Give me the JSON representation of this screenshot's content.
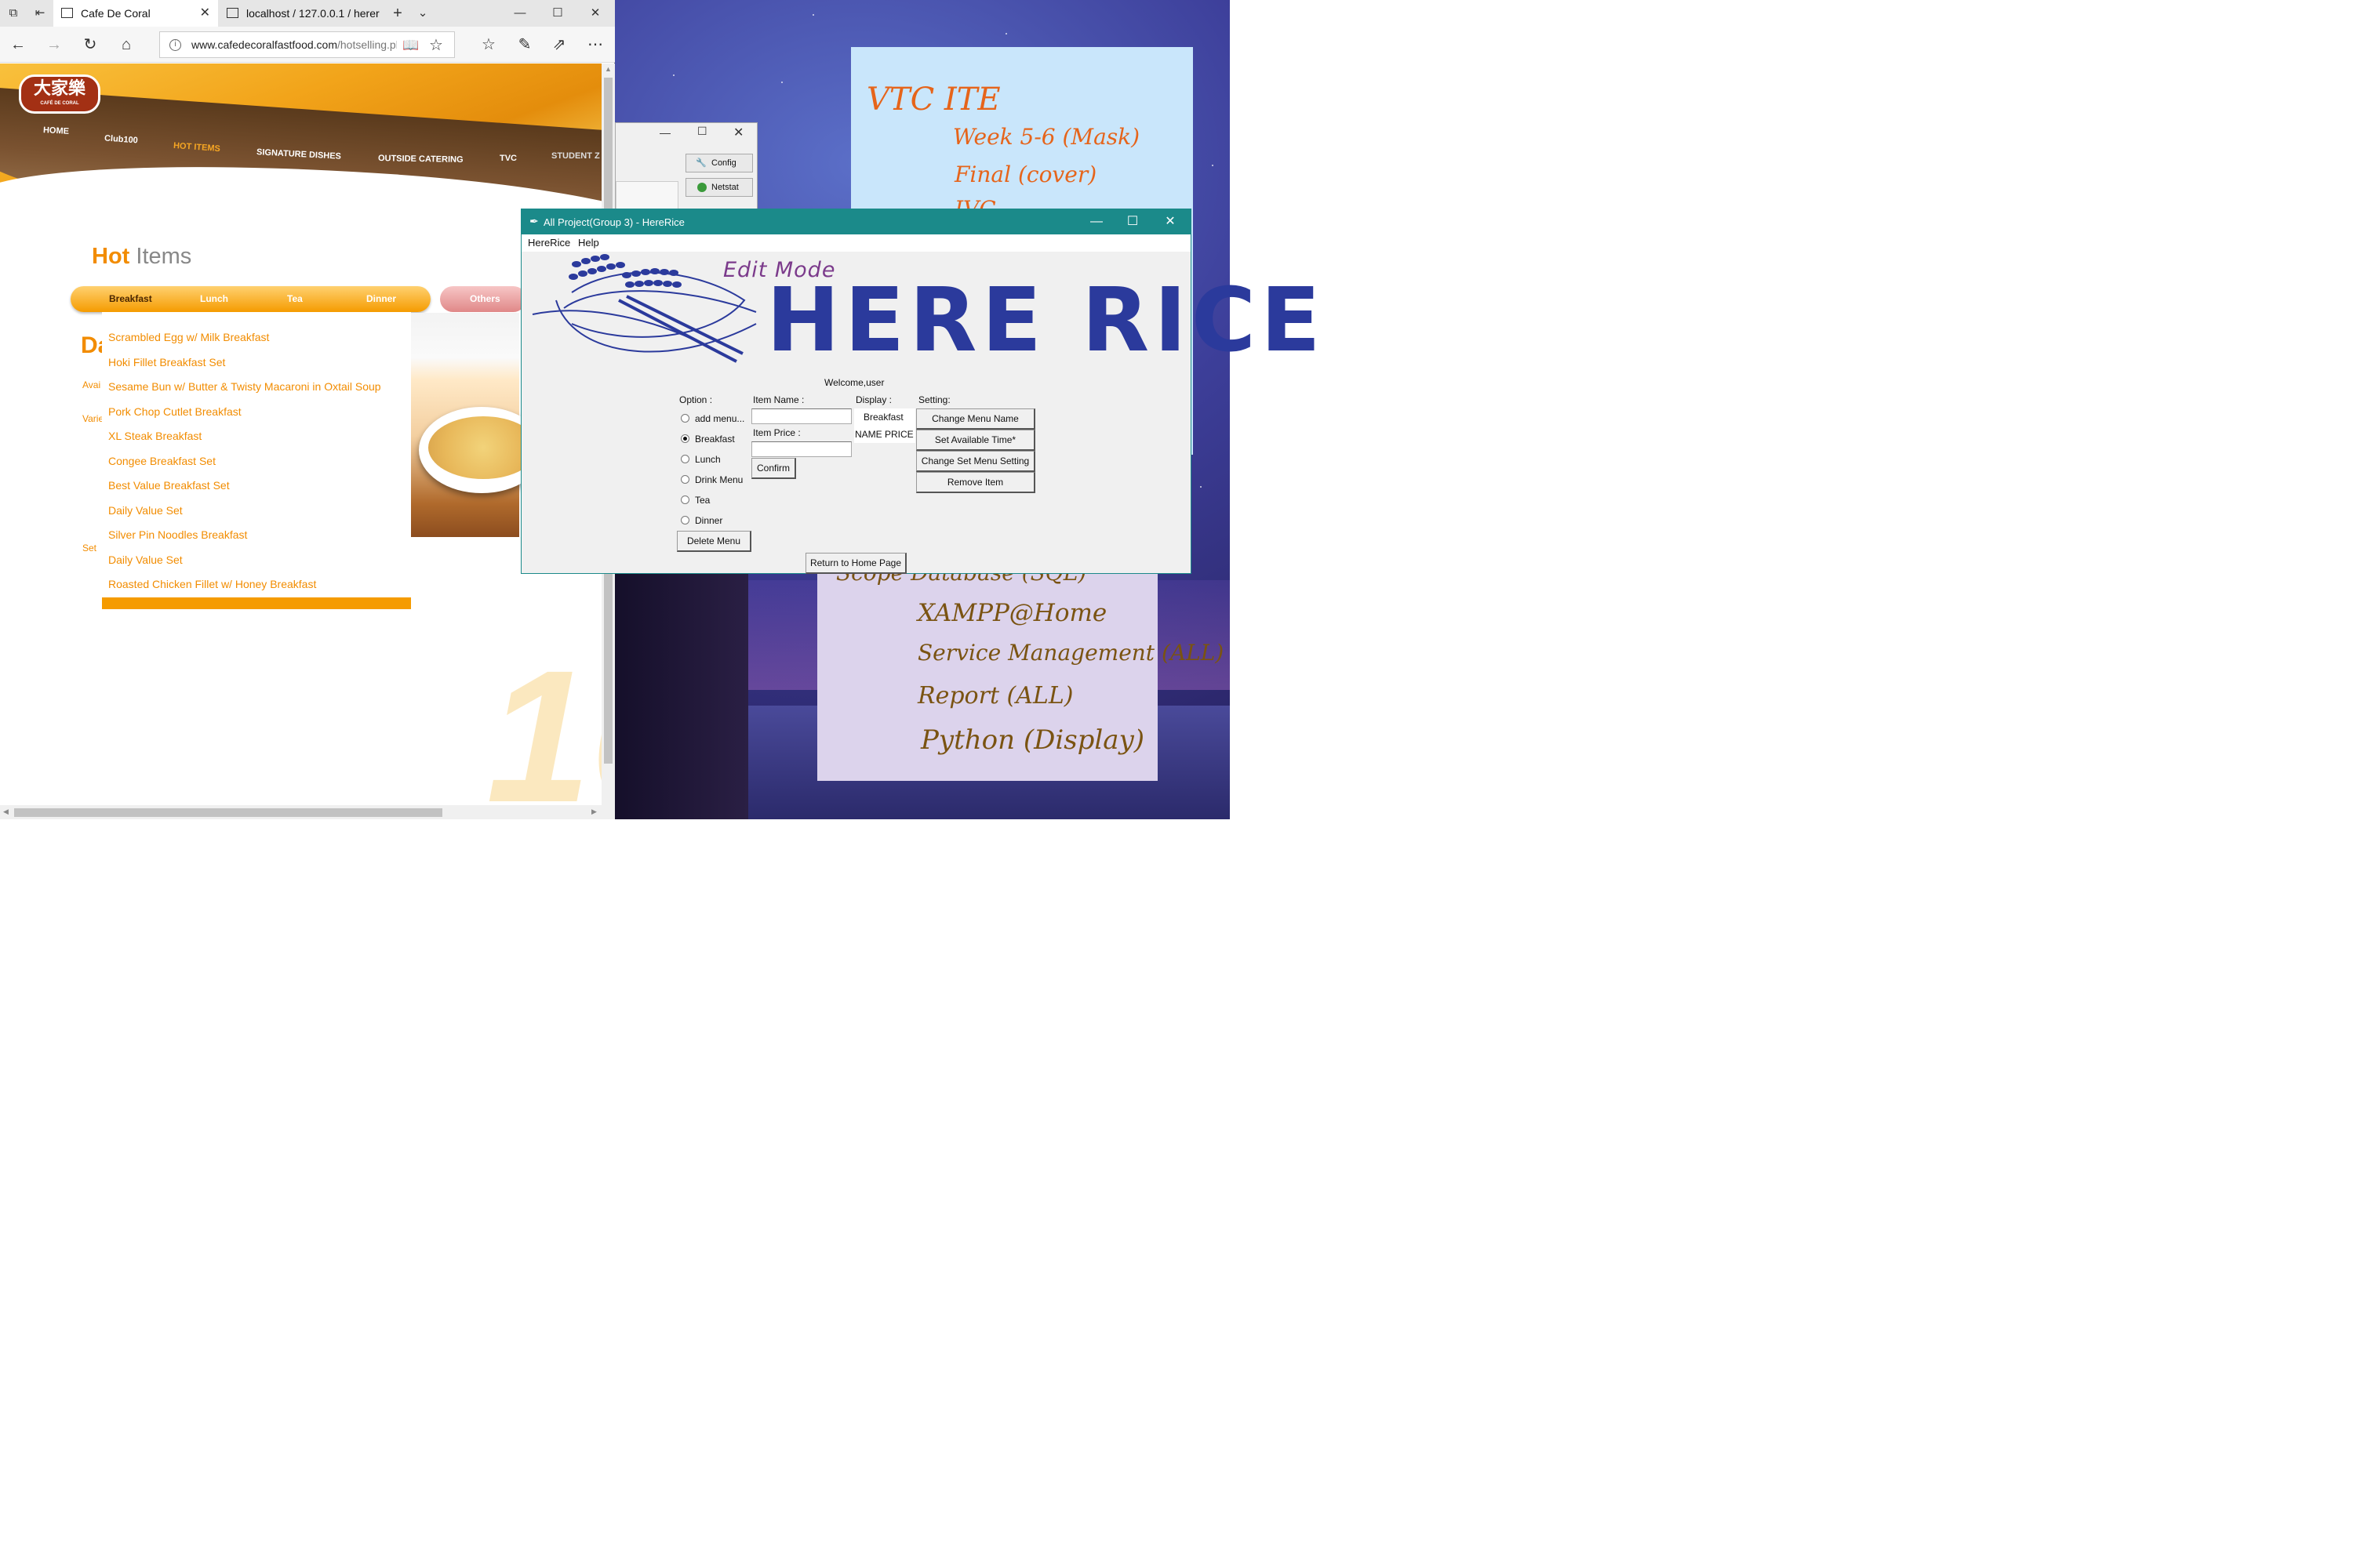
{
  "browser": {
    "tabs": [
      {
        "title": "Cafe De Coral",
        "active": true
      },
      {
        "title": "localhost / 127.0.0.1 / herer",
        "active": false
      }
    ],
    "url": {
      "domain": "www.cafedecoralfastfood.com",
      "path": "/hotselling.ph"
    },
    "site": {
      "logo_text": "大家樂",
      "logo_sub": "CAFÉ DE CORAL",
      "nav": [
        "HOME",
        "Club100",
        "HOT ITEMS",
        "SIGNATURE DISHES",
        "OUTSIDE CATERING",
        "TVC",
        "STUDENT Z"
      ],
      "heading_bold": "Hot",
      "heading_rest": " Items",
      "menu_tabs": [
        "Breakfast",
        "Lunch",
        "Tea",
        "Dinner"
      ],
      "others_tab": "Others",
      "dropdown_items": [
        "Scrambled Egg w/ Milk Breakfast",
        "Hoki Fillet Breakfast Set",
        "Sesame Bun w/ Butter & Twisty Macaroni in Oxtail Soup",
        "Pork Chop Cutlet Breakfast",
        "XL Steak Breakfast",
        "Congee Breakfast Set",
        "Best Value Breakfast Set",
        "Daily Value Set",
        "Silver Pin Noodles Breakfast",
        "Daily Value Set",
        "Roasted Chicken Fillet w/ Honey Breakfast"
      ],
      "side_letter": "Da",
      "side_labels": [
        "Avai",
        "Varie",
        "Set"
      ]
    }
  },
  "behind_window": {
    "buttons": [
      "Config",
      "Netstat"
    ]
  },
  "sticky_notes": {
    "top": [
      "VTC ITE",
      "Week 5-6 (Mask)",
      "Final (cover)",
      "IVC"
    ],
    "bottom": [
      "Scope  Database (SQL)",
      "XAMPP@Home",
      "Service Management (ALL)",
      "Report (ALL)",
      "Python (Display)"
    ]
  },
  "app": {
    "title": "All Project(Group 3) - HereRice",
    "menu": [
      "HereRice",
      "Help"
    ],
    "edit_mode": "Edit Mode",
    "logo_text": "HERE RICE",
    "welcome": "Welcome,user",
    "option_label": "Option :",
    "options": [
      "add menu...",
      "Breakfast",
      "Lunch",
      "Drink Menu",
      "Tea",
      "Dinner"
    ],
    "selected_option": "Breakfast",
    "item_name_label": "Item Name :",
    "item_name_value": "",
    "item_price_label": "Item Price :",
    "item_price_value": "",
    "confirm": "Confirm",
    "display_label": "Display :",
    "display_title": "Breakfast",
    "display_header": "NAME  PRICE",
    "setting_label": "Setting:",
    "settings": [
      "Change Menu Name",
      "Set Available Time*",
      "Change Set Menu Setting",
      "Remove Item"
    ],
    "delete_menu": "Delete Menu",
    "return_home": "Return to Home Page",
    "colors": {
      "titlebar": "#1b8a8a",
      "logo": "#2b3a9c",
      "edit_mode": "#7b3a8b"
    }
  }
}
